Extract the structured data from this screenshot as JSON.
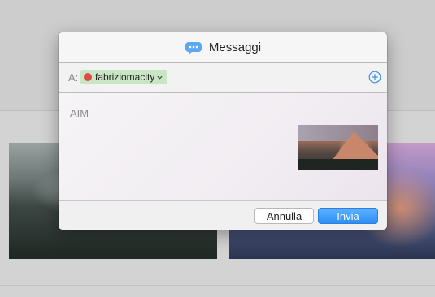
{
  "window": {
    "title": "Messaggi",
    "app_icon": "messages-bubble-icon"
  },
  "recipient_row": {
    "label": "A:",
    "recipient_name": "fabriziomacity",
    "status_color": "#e04848",
    "add_icon": "plus-circle-icon"
  },
  "message": {
    "service": "AIM",
    "attachment": "landscape-photo-thumbnail"
  },
  "buttons": {
    "cancel": "Annulla",
    "send": "Invia"
  },
  "colors": {
    "accent": "#2d8ff5",
    "recipient_pill": "#c8e6c4"
  }
}
